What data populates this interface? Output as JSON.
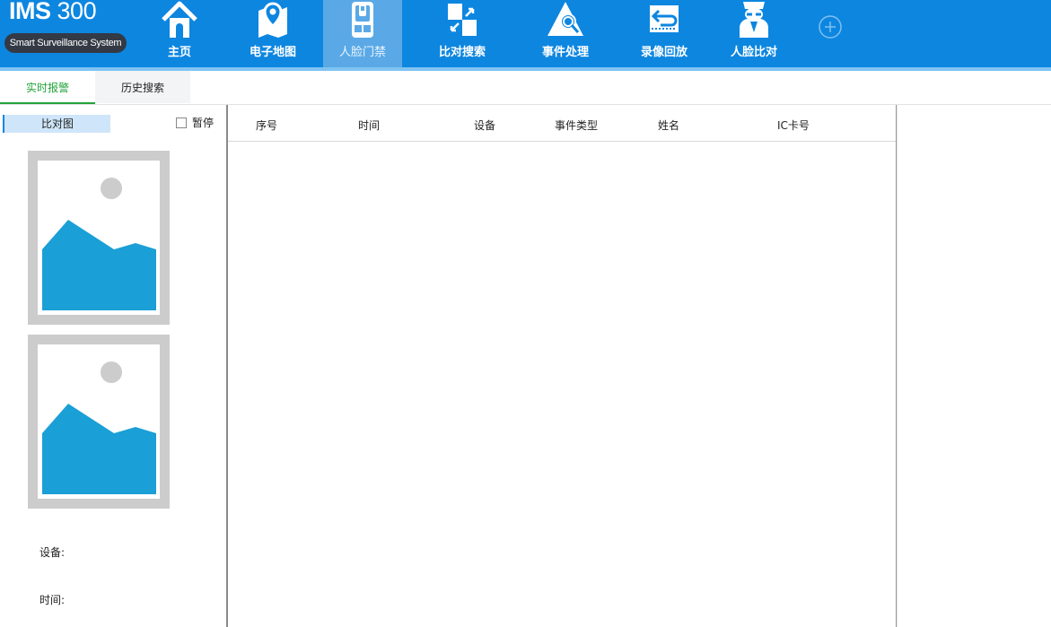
{
  "app": {
    "brand_name": "IMS",
    "brand_number": "300",
    "brand_subtitle": "Smart Surveillance System"
  },
  "nav": {
    "items": [
      {
        "label": "主页",
        "icon": "home-icon"
      },
      {
        "label": "电子地图",
        "icon": "map-icon"
      },
      {
        "label": "人脸门禁",
        "icon": "access-control-icon",
        "active": true
      },
      {
        "label": "比对搜索",
        "icon": "compare-search-icon"
      },
      {
        "label": "事件处理",
        "icon": "event-handling-icon"
      },
      {
        "label": "录像回放",
        "icon": "playback-icon"
      },
      {
        "label": "人脸比对",
        "icon": "face-compare-icon"
      }
    ],
    "add_icon": "plus-circle-icon"
  },
  "tabs": [
    {
      "label": "实时报警",
      "active": true
    },
    {
      "label": "历史搜索",
      "active": false
    }
  ],
  "left_panel": {
    "compare_label": "比对图",
    "pause_label": "暂停",
    "pause_checked": false,
    "device_label": "设备:",
    "time_label": "时间:"
  },
  "table": {
    "columns": [
      "序号",
      "时间",
      "设备",
      "事件类型",
      "姓名",
      "IC卡号"
    ],
    "rows": []
  },
  "colors": {
    "topbar": "#0d86e0",
    "active_nav": "#5aa9e6",
    "active_tab": "#22a33a",
    "placeholder_frame": "#cccccc",
    "placeholder_mountain": "#1a9fd6"
  }
}
